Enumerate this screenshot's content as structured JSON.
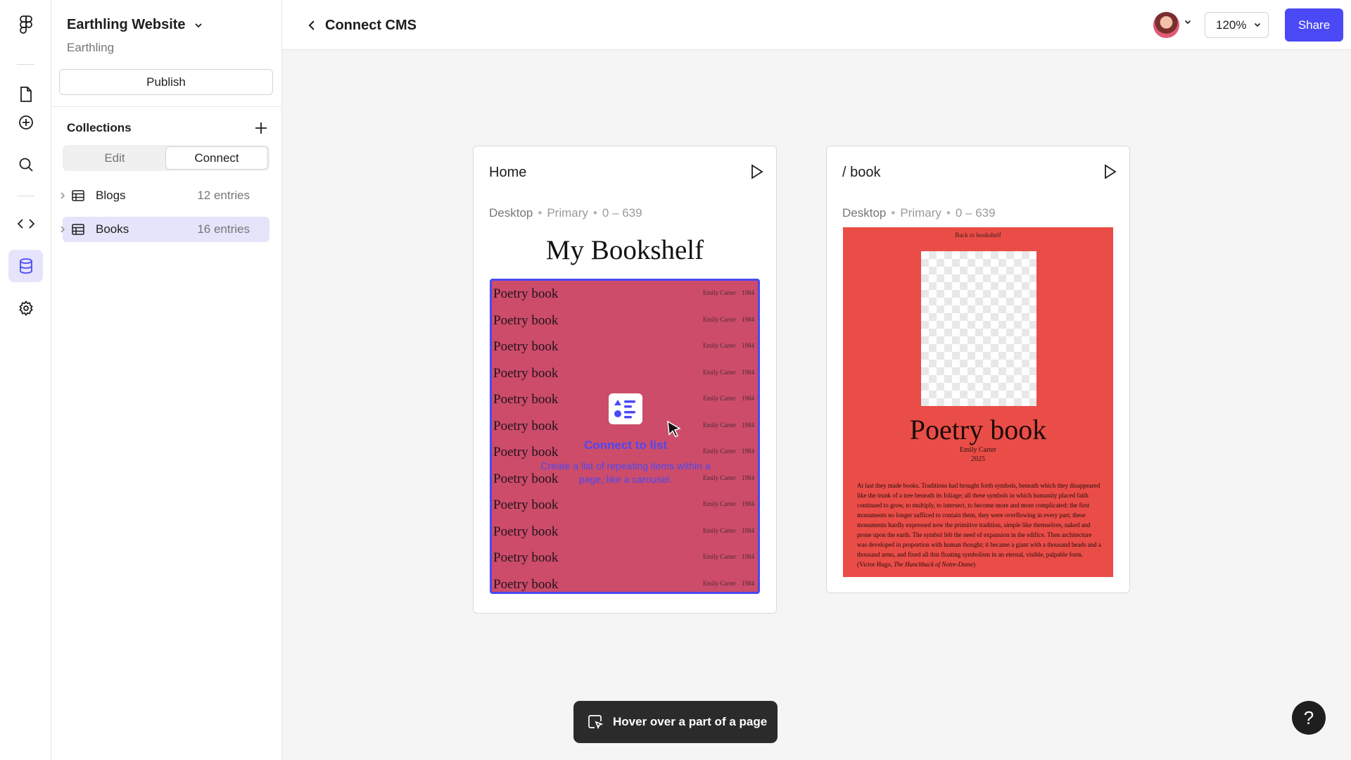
{
  "rail": {
    "icons": [
      "figma-logo-icon",
      "pages-icon",
      "insert-icon",
      "search-icon",
      "code-icon",
      "cms-icon",
      "settings-icon"
    ]
  },
  "sidebar": {
    "project_name": "Earthling Website",
    "team_name": "Earthling",
    "publish_label": "Publish",
    "collections_title": "Collections",
    "tabs": [
      "Edit",
      "Connect"
    ],
    "active_tab": "Connect",
    "collections": [
      {
        "name": "Blogs",
        "count": "12 entries"
      },
      {
        "name": "Books",
        "count": "16 entries"
      }
    ]
  },
  "header": {
    "title": "Connect CMS",
    "zoom": "120%",
    "share_label": "Share"
  },
  "pages": [
    {
      "name": "Home",
      "breakpoint": {
        "device": "Desktop",
        "type": "Primary",
        "range": "0 – 639"
      },
      "preview": {
        "title": "My Bookshelf",
        "rows": [
          {
            "title": "Poetry book",
            "author": "Emily Carter",
            "year": "1984"
          },
          {
            "title": "Poetry book",
            "author": "Emily Carter",
            "year": "1984"
          },
          {
            "title": "Poetry book",
            "author": "Emily Carter",
            "year": "1984"
          },
          {
            "title": "Poetry book",
            "author": "Emily Carter",
            "year": "1984"
          },
          {
            "title": "Poetry book",
            "author": "Emily Carter",
            "year": "1984"
          },
          {
            "title": "Poetry book",
            "author": "Emily Carter",
            "year": "1984"
          },
          {
            "title": "Poetry book",
            "author": "Emily Carter",
            "year": "1984"
          },
          {
            "title": "Poetry book",
            "author": "Emily Carter",
            "year": "1984"
          },
          {
            "title": "Poetry book",
            "author": "Emily Carter",
            "year": "1984"
          },
          {
            "title": "Poetry book",
            "author": "Emily Carter",
            "year": "1984"
          },
          {
            "title": "Poetry book",
            "author": "Emily Carter",
            "year": "1984"
          },
          {
            "title": "Poetry book",
            "author": "Emily Carter",
            "year": "1984"
          }
        ],
        "connect_title": "Connect to list",
        "connect_desc": "Create a list of repeating items within a page, like a carousel."
      }
    },
    {
      "name": "/ book",
      "breakpoint": {
        "device": "Desktop",
        "type": "Primary",
        "range": "0 – 639"
      },
      "preview": {
        "back_link": "Back to bookshelf",
        "title": "Poetry book",
        "author": "Emily Carter",
        "year": "2025",
        "body": "At last they made books. Traditions had brought forth symbols, beneath which they disappeared like the trunk of a tree beneath its foliage; all these symbols in which humanity placed faith continued to grow, to multiply, to intersect, to become more and more complicated; the first monuments no longer sufficed to contain them, they were overflowing in every part; these monuments hardly expressed now the primitive tradition, simple like themselves, naked and prone upon the earth. The symbol felt the need of expansion in the edifice. Then architecture was developed in proportion with human thought; it became a giant with a thousand heads and a thousand arms, and fixed all this floating symbolism in an eternal, visible, palpable form. (Victor Hugo, ",
        "body_cite": "The Hunchback of Notre-Dame",
        "body_end": ")"
      }
    }
  ],
  "toast": {
    "label": "Hover over a part of a page"
  },
  "help_label": "?",
  "colors": {
    "accent": "#4b49f5",
    "home_list_bg": "#cc4c6a",
    "book_bg": "#ea4d47"
  }
}
